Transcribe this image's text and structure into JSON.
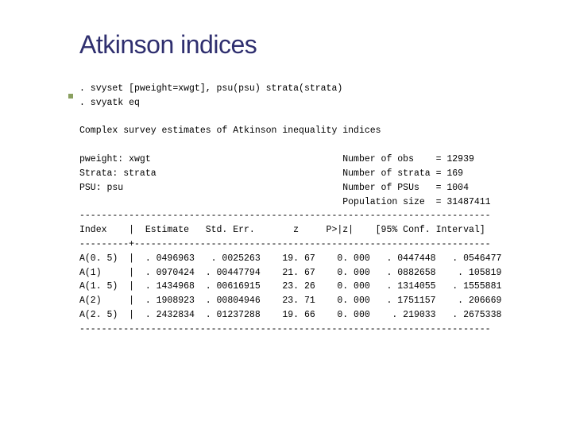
{
  "title": "Atkinson indices",
  "cmd1": ". svyset [pweight=xwgt], psu(psu) strata(strata)",
  "cmd2": ". svyatk eq",
  "blank1": " ",
  "desc": "Complex survey estimates of Atkinson inequality indices",
  "blank2": " ",
  "meta1": "pweight: xwgt                                   Number of obs    = 12939",
  "meta2": "Strata: strata                                  Number of strata = 169",
  "meta3": "PSU: psu                                        Number of PSUs   = 1004",
  "meta4": "                                                Population size  = 31487411",
  "rule1": "---------------------------------------------------------------------------",
  "hdr": "Index    |  Estimate   Std. Err.       z     P>|z|    [95% Conf. Interval]",
  "rule2": "---------+-----------------------------------------------------------------",
  "r1": "A(0. 5)  |  . 0496963   . 0025263    19. 67    0. 000   . 0447448   . 0546477",
  "r2": "A(1)     |  . 0970424  . 00447794    21. 67    0. 000   . 0882658    . 105819",
  "r3": "A(1. 5)  |  . 1434968  . 00616915    23. 26    0. 000   . 1314055   . 1555881",
  "r4": "A(2)     |  . 1908923  . 00804946    23. 71    0. 000   . 1751157    . 206669",
  "r5": "A(2. 5)  |  . 2432834  . 01237288    19. 66    0. 000    . 219033   . 2675338",
  "rule3": "---------------------------------------------------------------------------"
}
